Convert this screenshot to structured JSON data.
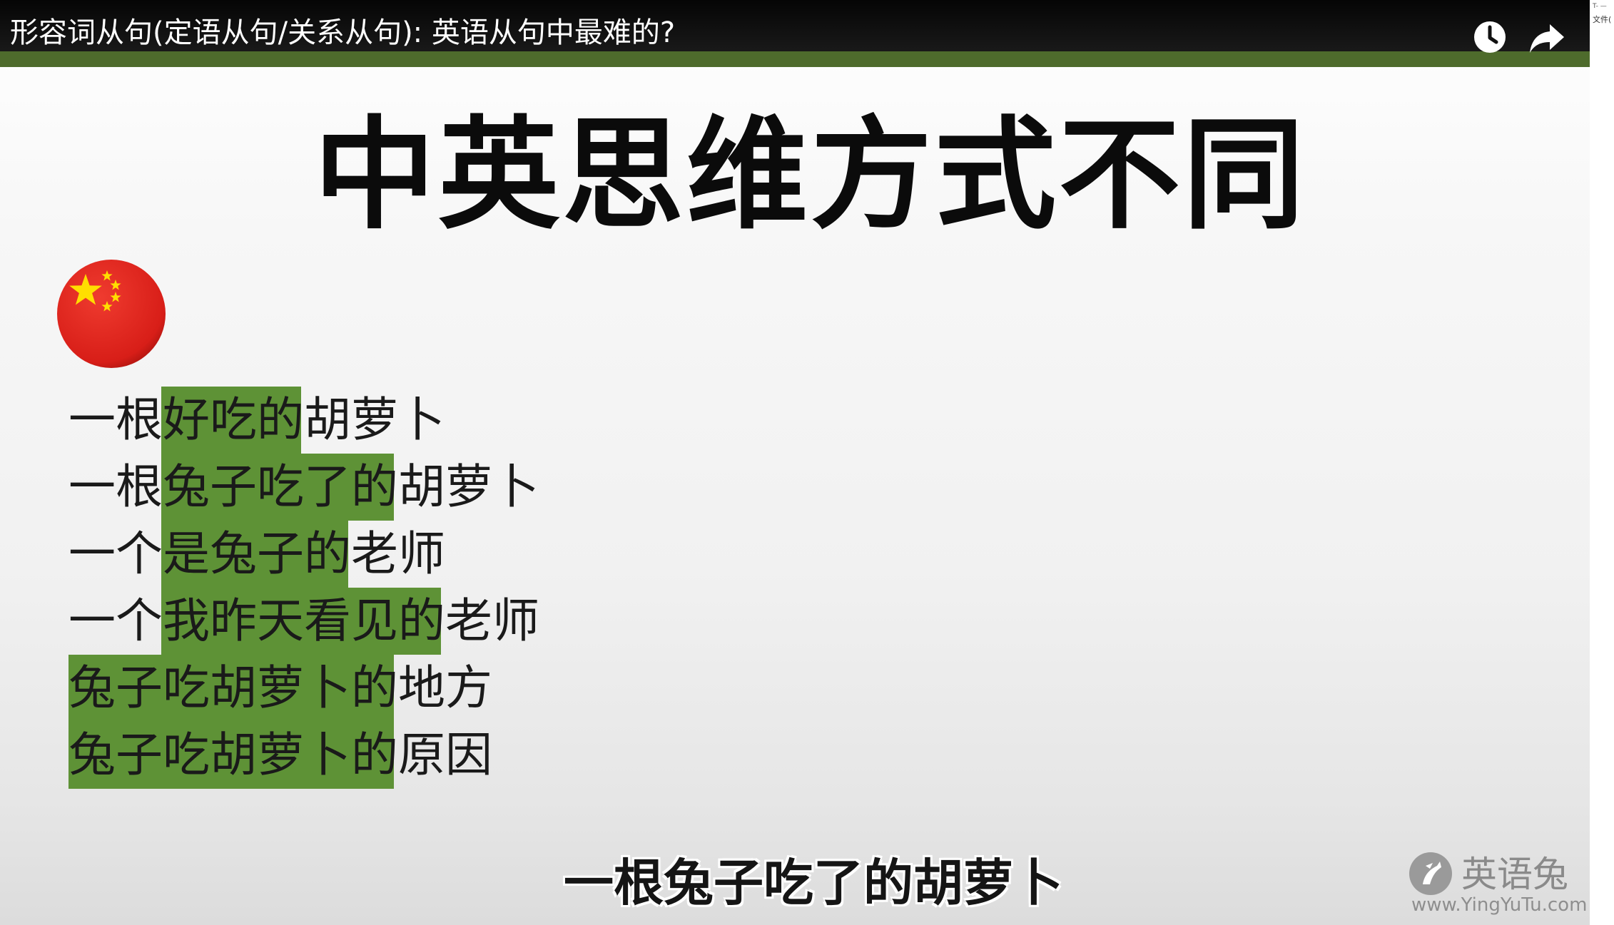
{
  "video": {
    "title": "形容词从句(定语从句/关系从句): 英语从句中最难的?",
    "watch_later_icon": "clock-icon",
    "share_icon": "share-arrow-icon",
    "band_color": "#4e6b2c"
  },
  "slide": {
    "title": "中英思维方式不同",
    "flag_icon": "china-flag-icon",
    "highlight_color": "#5e9236",
    "lines": [
      {
        "before": "一根",
        "highlight": "好吃的",
        "after": "胡萝卜"
      },
      {
        "before": "一根",
        "highlight": "兔子吃了的",
        "after": "胡萝卜"
      },
      {
        "before": "一个",
        "highlight": "是兔子的",
        "after": "老师"
      },
      {
        "before": "一个",
        "highlight": "我昨天看见的",
        "after": "老师"
      },
      {
        "before": "",
        "highlight": "兔子吃胡萝卜的",
        "after": "地方"
      },
      {
        "before": "",
        "highlight": "兔子吃胡萝卜的",
        "after": "原因"
      }
    ]
  },
  "subtitle": "一根兔子吃了的胡萝卜",
  "watermark": {
    "name": "英语兔",
    "url": "www.YingYuTu.com"
  },
  "side_panel": {
    "top_text": "T- —",
    "label": "文件("
  }
}
